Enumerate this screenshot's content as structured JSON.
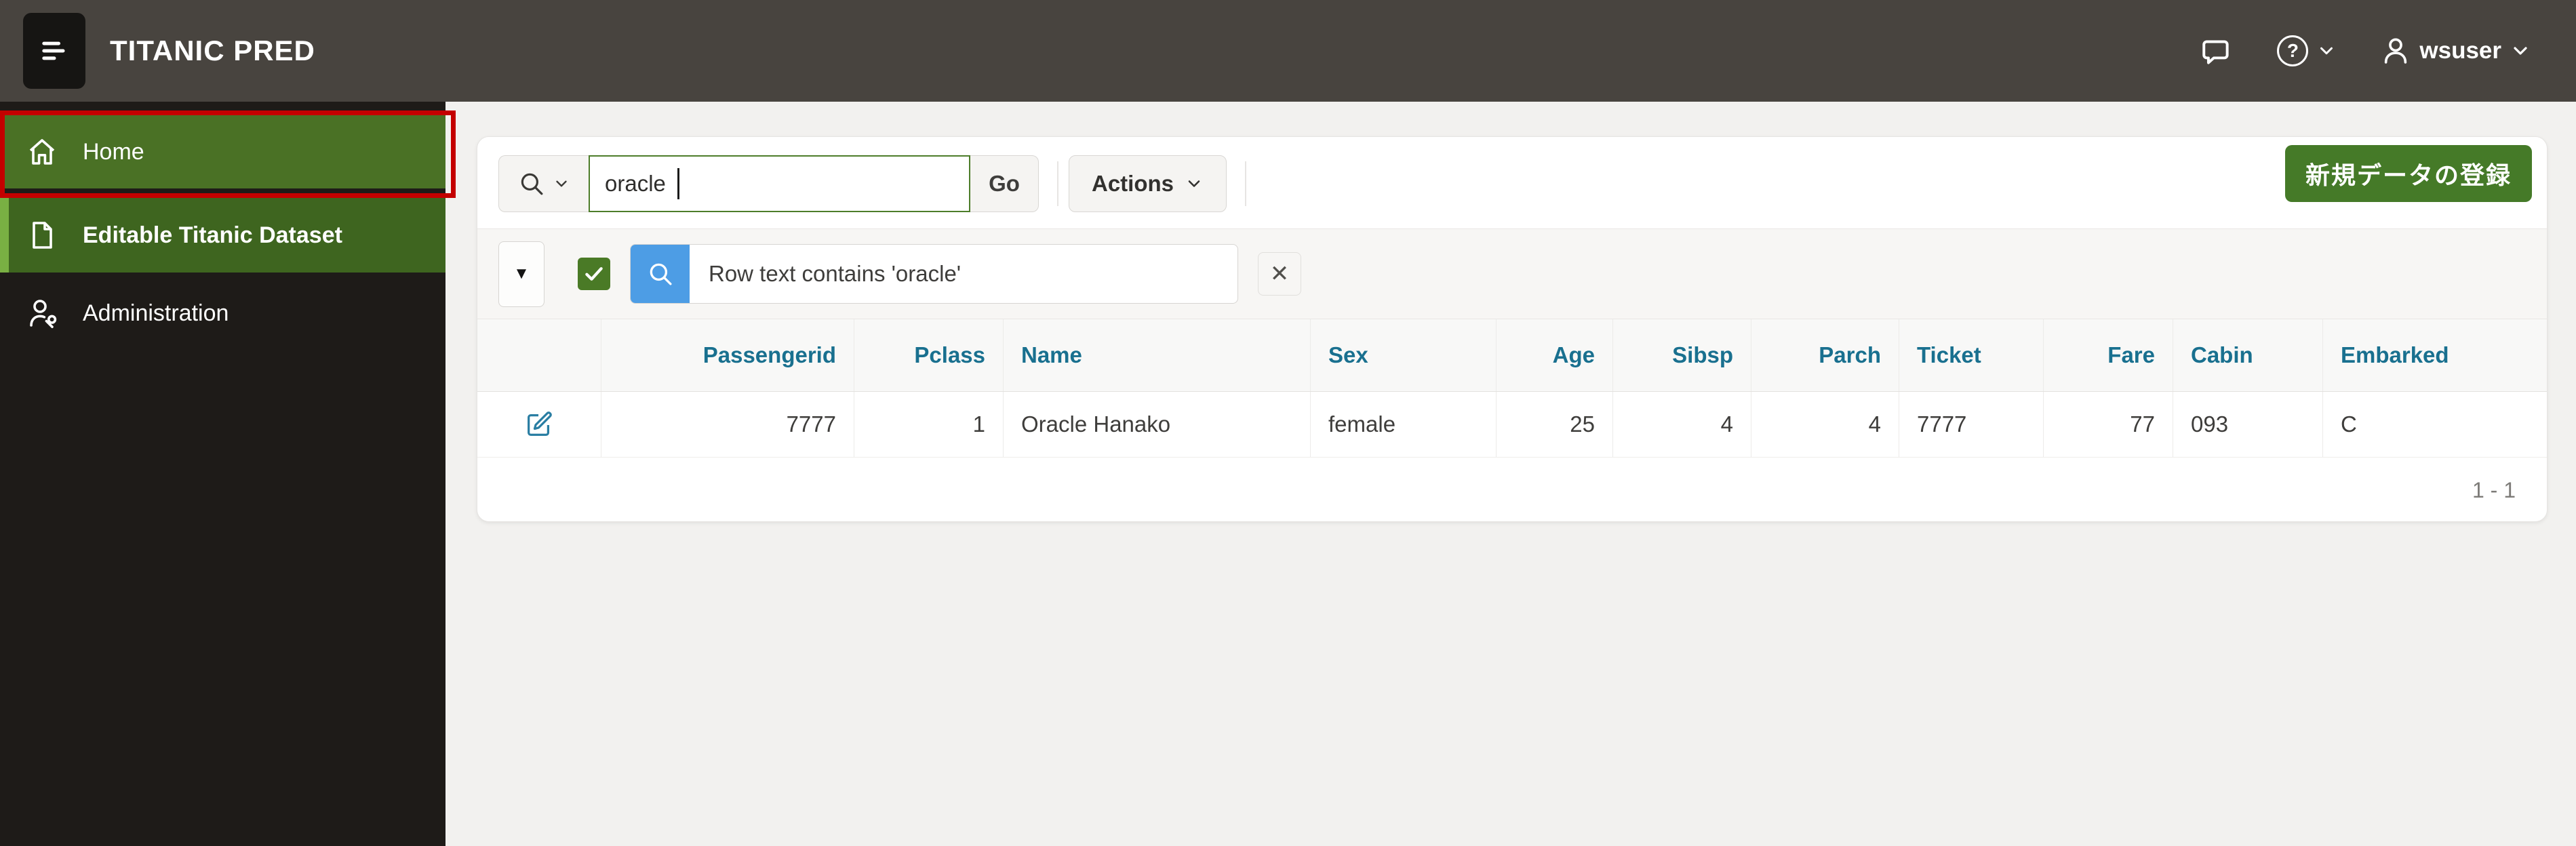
{
  "header": {
    "app_title": "TITANIC PRED",
    "user_name": "wsuser"
  },
  "sidebar": {
    "items": [
      {
        "label": "Home",
        "icon": "home-icon",
        "state": "highlighted"
      },
      {
        "label": "Editable Titanic Dataset",
        "icon": "document-icon",
        "state": "current"
      },
      {
        "label": "Administration",
        "icon": "admin-wrench-icon",
        "state": "normal"
      }
    ]
  },
  "toolbar": {
    "search_value": "oracle",
    "go_label": "Go",
    "actions_label": "Actions",
    "create_label": "新規データの登録"
  },
  "filter": {
    "text": "Row text contains 'oracle'",
    "checked": true
  },
  "table": {
    "columns": [
      "",
      "Passengerid",
      "Pclass",
      "Name",
      "Sex",
      "Age",
      "Sibsp",
      "Parch",
      "Ticket",
      "Fare",
      "Cabin",
      "Embarked"
    ],
    "rows": [
      {
        "cells": [
          "7777",
          "1",
          "Oracle Hanako",
          "female",
          "25",
          "4",
          "4",
          "7777",
          "77",
          "093",
          "C"
        ]
      }
    ],
    "pagination": "1 - 1"
  },
  "icons": {
    "help_glyph": "?",
    "triangle_down_glyph": "▼",
    "close_glyph": "✕"
  },
  "colors": {
    "header_bg": "#48443F",
    "sidebar_bg": "#1E1B18",
    "home_green": "#4A7125",
    "current_green": "#3E651F",
    "current_accent_bar": "#79B043",
    "annotation_red": "#C40000",
    "create_button_green": "#457A28",
    "focus_border_green": "#4D7D2A",
    "filter_blue": "#4D9DE5",
    "column_header_teal": "#19708F"
  }
}
